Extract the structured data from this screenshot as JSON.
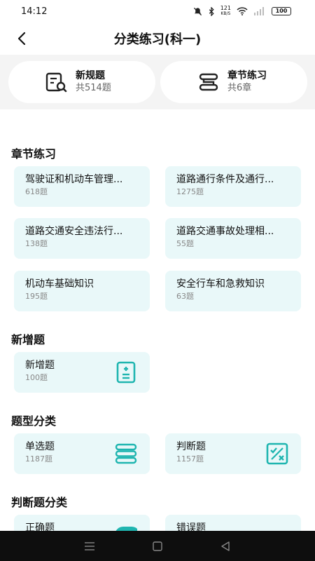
{
  "status_bar": {
    "time": "14:12",
    "net_speed_value": "121",
    "net_speed_unit": "KB/S",
    "battery": "100"
  },
  "header": {
    "title": "分类练习(科一)",
    "back_icon": "chevron-left-icon"
  },
  "top_cards": [
    {
      "title": "新规题",
      "subtitle": "共514题",
      "icon": "document-search-icon"
    },
    {
      "title": "章节练习",
      "subtitle": "共6章",
      "icon": "chapter-list-icon"
    }
  ],
  "sections": {
    "chapters": {
      "title": "章节练习",
      "items": [
        {
          "title": "驾驶证和机动车管理...",
          "count": "618题"
        },
        {
          "title": "道路通行条件及通行...",
          "count": "1275题"
        },
        {
          "title": "道路交通安全违法行...",
          "count": "138题"
        },
        {
          "title": "道路交通事故处理相...",
          "count": "55题"
        },
        {
          "title": "机动车基础知识",
          "count": "195题"
        },
        {
          "title": "安全行车和急救知识",
          "count": "63题"
        }
      ]
    },
    "new_questions": {
      "title": "新增题",
      "items": [
        {
          "title": "新增题",
          "count": "100题",
          "icon": "calculator-doc-icon"
        }
      ]
    },
    "question_types": {
      "title": "题型分类",
      "items": [
        {
          "title": "单选题",
          "count": "1187题",
          "icon": "stack-list-icon"
        },
        {
          "title": "判断题",
          "count": "1157题",
          "icon": "check-cross-icon"
        }
      ]
    },
    "judgment_types": {
      "title": "判断题分类",
      "items": [
        {
          "title": "正确题",
          "icon": "correct-icon"
        },
        {
          "title": "错误题",
          "icon": "wrong-icon"
        }
      ]
    }
  },
  "colors": {
    "accent": "#1fb5b0",
    "card_bg": "#e9f8f9",
    "band_bg": "#f4f4f4",
    "nav_bg": "#0e0e0e"
  }
}
